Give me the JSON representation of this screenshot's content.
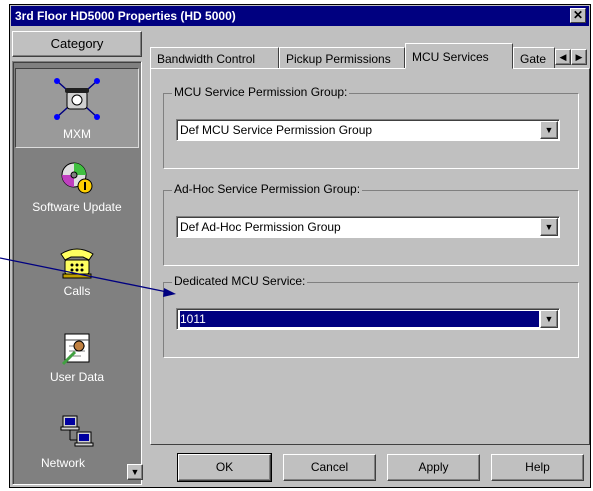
{
  "window": {
    "title": "3rd Floor HD5000 Properties (HD 5000)",
    "close_glyph": "✕"
  },
  "category": {
    "header": "Category",
    "items": [
      {
        "label": "MXM",
        "icon": "phone-network-icon",
        "selected": true
      },
      {
        "label": "Software Update",
        "icon": "cd-update-icon",
        "selected": false
      },
      {
        "label": "Calls",
        "icon": "telephone-icon",
        "selected": false
      },
      {
        "label": "User Data",
        "icon": "notepad-icon",
        "selected": false
      },
      {
        "label": "Network",
        "icon": "computers-network-icon",
        "selected": false
      }
    ],
    "scroll_down_glyph": "▼"
  },
  "tabs": {
    "items": [
      "Bandwidth Control",
      "Pickup Permissions",
      "MCU Services",
      "Gate"
    ],
    "active": "MCU Services",
    "scroll_left_glyph": "◀",
    "scroll_right_glyph": "▶"
  },
  "groups": [
    {
      "title": "MCU Service Permission Group:",
      "value": "Def MCU Service Permission Group",
      "highlighted": false
    },
    {
      "title": "Ad-Hoc Service Permission Group:",
      "value": "Def Ad-Hoc Permission Group",
      "highlighted": false
    },
    {
      "title": "Dedicated MCU Service:",
      "value": "1011",
      "highlighted": true
    }
  ],
  "dropdown_glyph": "▼",
  "buttons": {
    "ok": "OK",
    "cancel": "Cancel",
    "apply": "Apply",
    "help": "Help"
  },
  "colors": {
    "titlebar": "#000080",
    "face": "#c0c0c0",
    "selection": "#000080",
    "callout_arrow": "#000080"
  }
}
